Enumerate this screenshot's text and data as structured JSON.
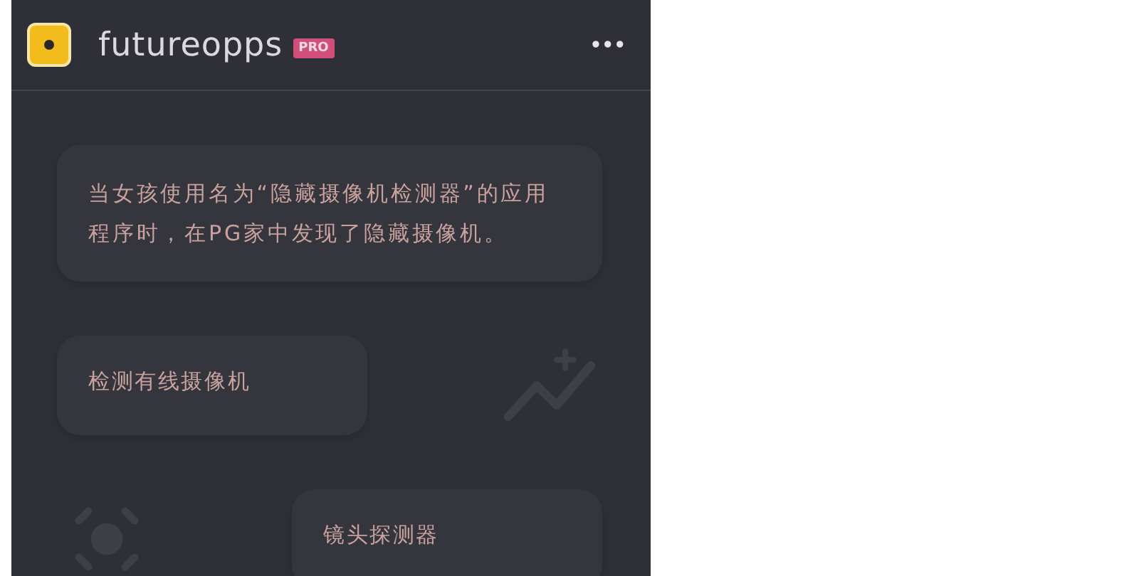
{
  "header": {
    "app_name": "futureopps",
    "badge": "PRO",
    "menu": "•••"
  },
  "cards": [
    {
      "kind": "message",
      "text": "当女孩使用名为“隐藏摄像机检测器”的应用程序时，在PG家中发现了隐藏摄像机。"
    },
    {
      "kind": "feature",
      "text": "检测有线摄像机"
    },
    {
      "kind": "feature",
      "text": "镜头探测器"
    }
  ]
}
